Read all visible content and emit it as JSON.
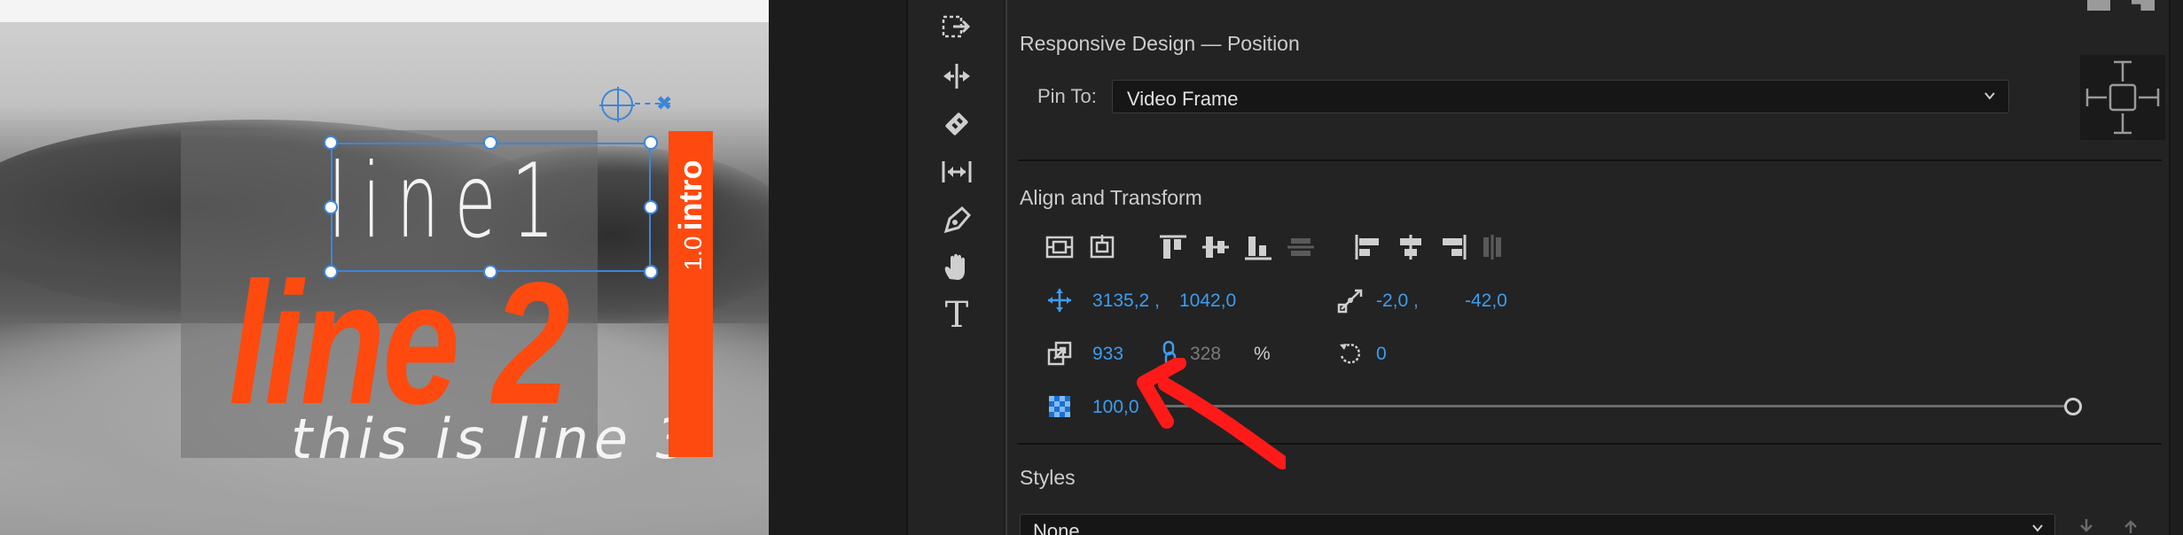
{
  "monitor": {
    "title_line1": "line1",
    "title_line2": "line 2",
    "title_line3": "this is line 3",
    "bar_version": "1.0",
    "bar_label": "intro"
  },
  "tools": [
    "track-select-forward-icon",
    "ripple-edit-icon",
    "razor-icon",
    "slip-icon",
    "pen-icon",
    "hand-icon",
    "type-icon"
  ],
  "tools_type_glyph": "T",
  "panel": {
    "responsive_title": "Responsive Design — Position",
    "pin_to_label": "Pin To:",
    "pin_to_value": "Video Frame",
    "align_title": "Align and Transform",
    "position_x": "3135,2 ,",
    "position_y": "1042,0",
    "anchor_x": "-2,0 ,",
    "anchor_y": "-42,0",
    "scale": "933",
    "scale_height": "328",
    "scale_unit": "%",
    "rotation": "0",
    "opacity": "100,0",
    "styles_title": "Styles",
    "styles_value": "None"
  },
  "colors": {
    "accent_blue": "#3d9df0",
    "title_orange": "#ff4a0f",
    "annotation_red": "#ff1a1a",
    "panel_bg": "#232323"
  }
}
